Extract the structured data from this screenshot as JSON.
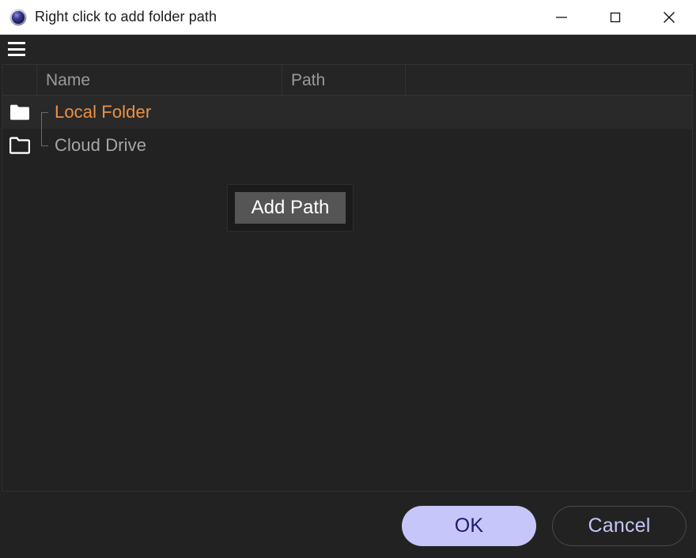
{
  "window": {
    "title": "Right click to add folder path",
    "app_icon": "sphere-icon",
    "controls": [
      {
        "name": "minimize",
        "glyph": "minimize-icon"
      },
      {
        "name": "maximize",
        "glyph": "maximize-icon"
      },
      {
        "name": "close",
        "glyph": "close-icon"
      }
    ]
  },
  "toolbar": {
    "menu_icon": "hamburger-menu-icon"
  },
  "list": {
    "columns": [
      {
        "key": "tree",
        "label": ""
      },
      {
        "key": "name",
        "label": "Name"
      },
      {
        "key": "path",
        "label": "Path"
      },
      {
        "key": "extra",
        "label": ""
      }
    ],
    "rows": [
      {
        "name": "Local Folder",
        "path": "",
        "icon": "folder-filled-icon",
        "selected": true
      },
      {
        "name": "Cloud Drive",
        "path": "",
        "icon": "folder-outline-icon",
        "selected": false
      }
    ]
  },
  "context_menu": {
    "visible": true,
    "items": [
      {
        "label": "Add Path",
        "highlighted": true
      }
    ]
  },
  "footer": {
    "ok_label": "OK",
    "cancel_label": "Cancel"
  },
  "colors": {
    "titlebar_bg": "#ffffff",
    "titlebar_text": "#1b1b1b",
    "window_bg": "#222222",
    "toolbar_bg": "#242424",
    "header_text": "#9a9a9a",
    "accent_orange": "#ef9142",
    "row_text": "#a6a6a6",
    "row_selected_bg": "#292929",
    "context_menu_bg": "#1b1b1b",
    "context_item_bg": "#555555",
    "ok_fill": "#c6c6fb",
    "ok_text": "#1c1c6e",
    "cancel_text": "#c6c6fb",
    "cancel_border": "#4a4a4a"
  }
}
